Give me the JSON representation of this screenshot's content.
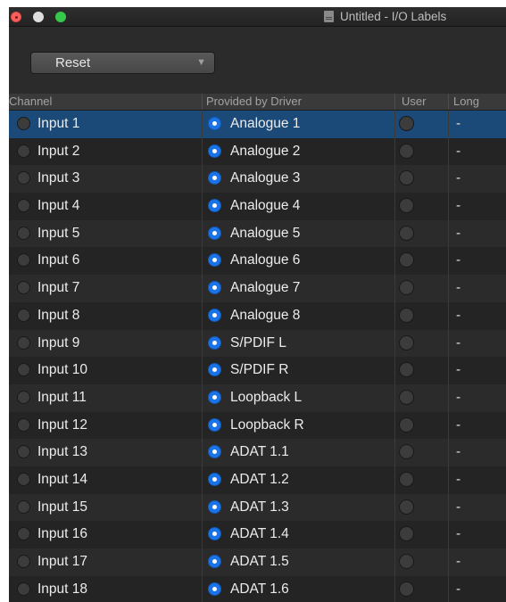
{
  "window": {
    "title": "Untitled - I/O Labels"
  },
  "toolbar": {
    "reset_label": "Reset"
  },
  "table": {
    "headers": {
      "channel": "Channel",
      "provided": "Provided by Driver",
      "user": "User",
      "long": "Long"
    },
    "selected_row": 0,
    "rows": [
      {
        "channel": "Input 1",
        "provided": "Analogue 1",
        "long": "-"
      },
      {
        "channel": "Input 2",
        "provided": "Analogue 2",
        "long": "-"
      },
      {
        "channel": "Input 3",
        "provided": "Analogue 3",
        "long": "-"
      },
      {
        "channel": "Input 4",
        "provided": "Analogue 4",
        "long": "-"
      },
      {
        "channel": "Input 5",
        "provided": "Analogue 5",
        "long": "-"
      },
      {
        "channel": "Input 6",
        "provided": "Analogue 6",
        "long": "-"
      },
      {
        "channel": "Input 7",
        "provided": "Analogue 7",
        "long": "-"
      },
      {
        "channel": "Input 8",
        "provided": "Analogue 8",
        "long": "-"
      },
      {
        "channel": "Input 9",
        "provided": "S/PDIF L",
        "long": "-"
      },
      {
        "channel": "Input 10",
        "provided": "S/PDIF R",
        "long": "-"
      },
      {
        "channel": "Input 11",
        "provided": "Loopback L",
        "long": "-"
      },
      {
        "channel": "Input 12",
        "provided": "Loopback R",
        "long": "-"
      },
      {
        "channel": "Input 13",
        "provided": "ADAT 1.1",
        "long": "-"
      },
      {
        "channel": "Input 14",
        "provided": "ADAT 1.2",
        "long": "-"
      },
      {
        "channel": "Input 15",
        "provided": "ADAT 1.3",
        "long": "-"
      },
      {
        "channel": "Input 16",
        "provided": "ADAT 1.4",
        "long": "-"
      },
      {
        "channel": "Input 17",
        "provided": "ADAT 1.5",
        "long": "-"
      },
      {
        "channel": "Input 18",
        "provided": "ADAT 1.6",
        "long": "-"
      }
    ]
  },
  "colors": {
    "row_even": "#2b2b2b",
    "row_odd": "#242424",
    "row_selected": "#1c4a78",
    "radio_selected": "#1a74e8"
  }
}
